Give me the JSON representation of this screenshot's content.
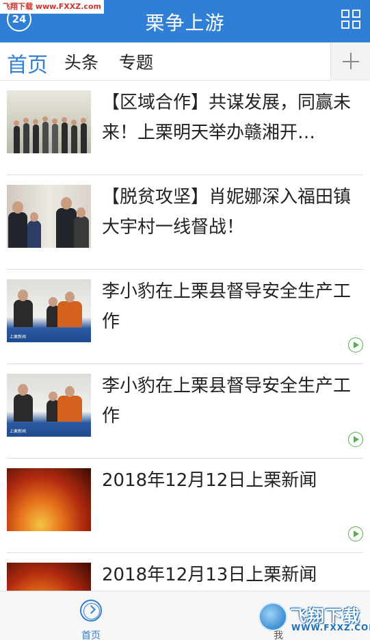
{
  "header": {
    "title": "栗争上游",
    "date_badge": "24",
    "watermark": "飞翔下载 www.FXXZ.com"
  },
  "tabs": [
    {
      "label": "首页",
      "active": true
    },
    {
      "label": "头条",
      "active": false
    },
    {
      "label": "专题",
      "active": false
    }
  ],
  "news": [
    {
      "title": "【区域合作】共谋发展，同赢未来！上栗明天举办赣湘开…",
      "video": false,
      "thumb": "meeting-photo"
    },
    {
      "title": "【脱贫攻坚】肖妮娜深入福田镇大宇村一线督战！",
      "video": false,
      "thumb": "visit-photo"
    },
    {
      "title": "李小豹在上栗县督导安全生产工作",
      "video": true,
      "thumb": "safety-photo"
    },
    {
      "title": "李小豹在上栗县督导安全生产工作",
      "video": true,
      "thumb": "safety-photo"
    },
    {
      "title": "2018年12月12日上栗新闻",
      "video": true,
      "thumb": "news-video"
    },
    {
      "title": "2018年12月13日上栗新闻",
      "video": true,
      "thumb": "news-video"
    }
  ],
  "thumb_caption": "上栗新闻",
  "bottom_nav": {
    "home_label": "首页",
    "me_label": "我"
  },
  "watermark": {
    "brand": "飞翔下载",
    "url": "WWW.FXXZ.COM"
  },
  "colors": {
    "accent": "#2f7fd6",
    "video_icon": "#56b24a"
  }
}
